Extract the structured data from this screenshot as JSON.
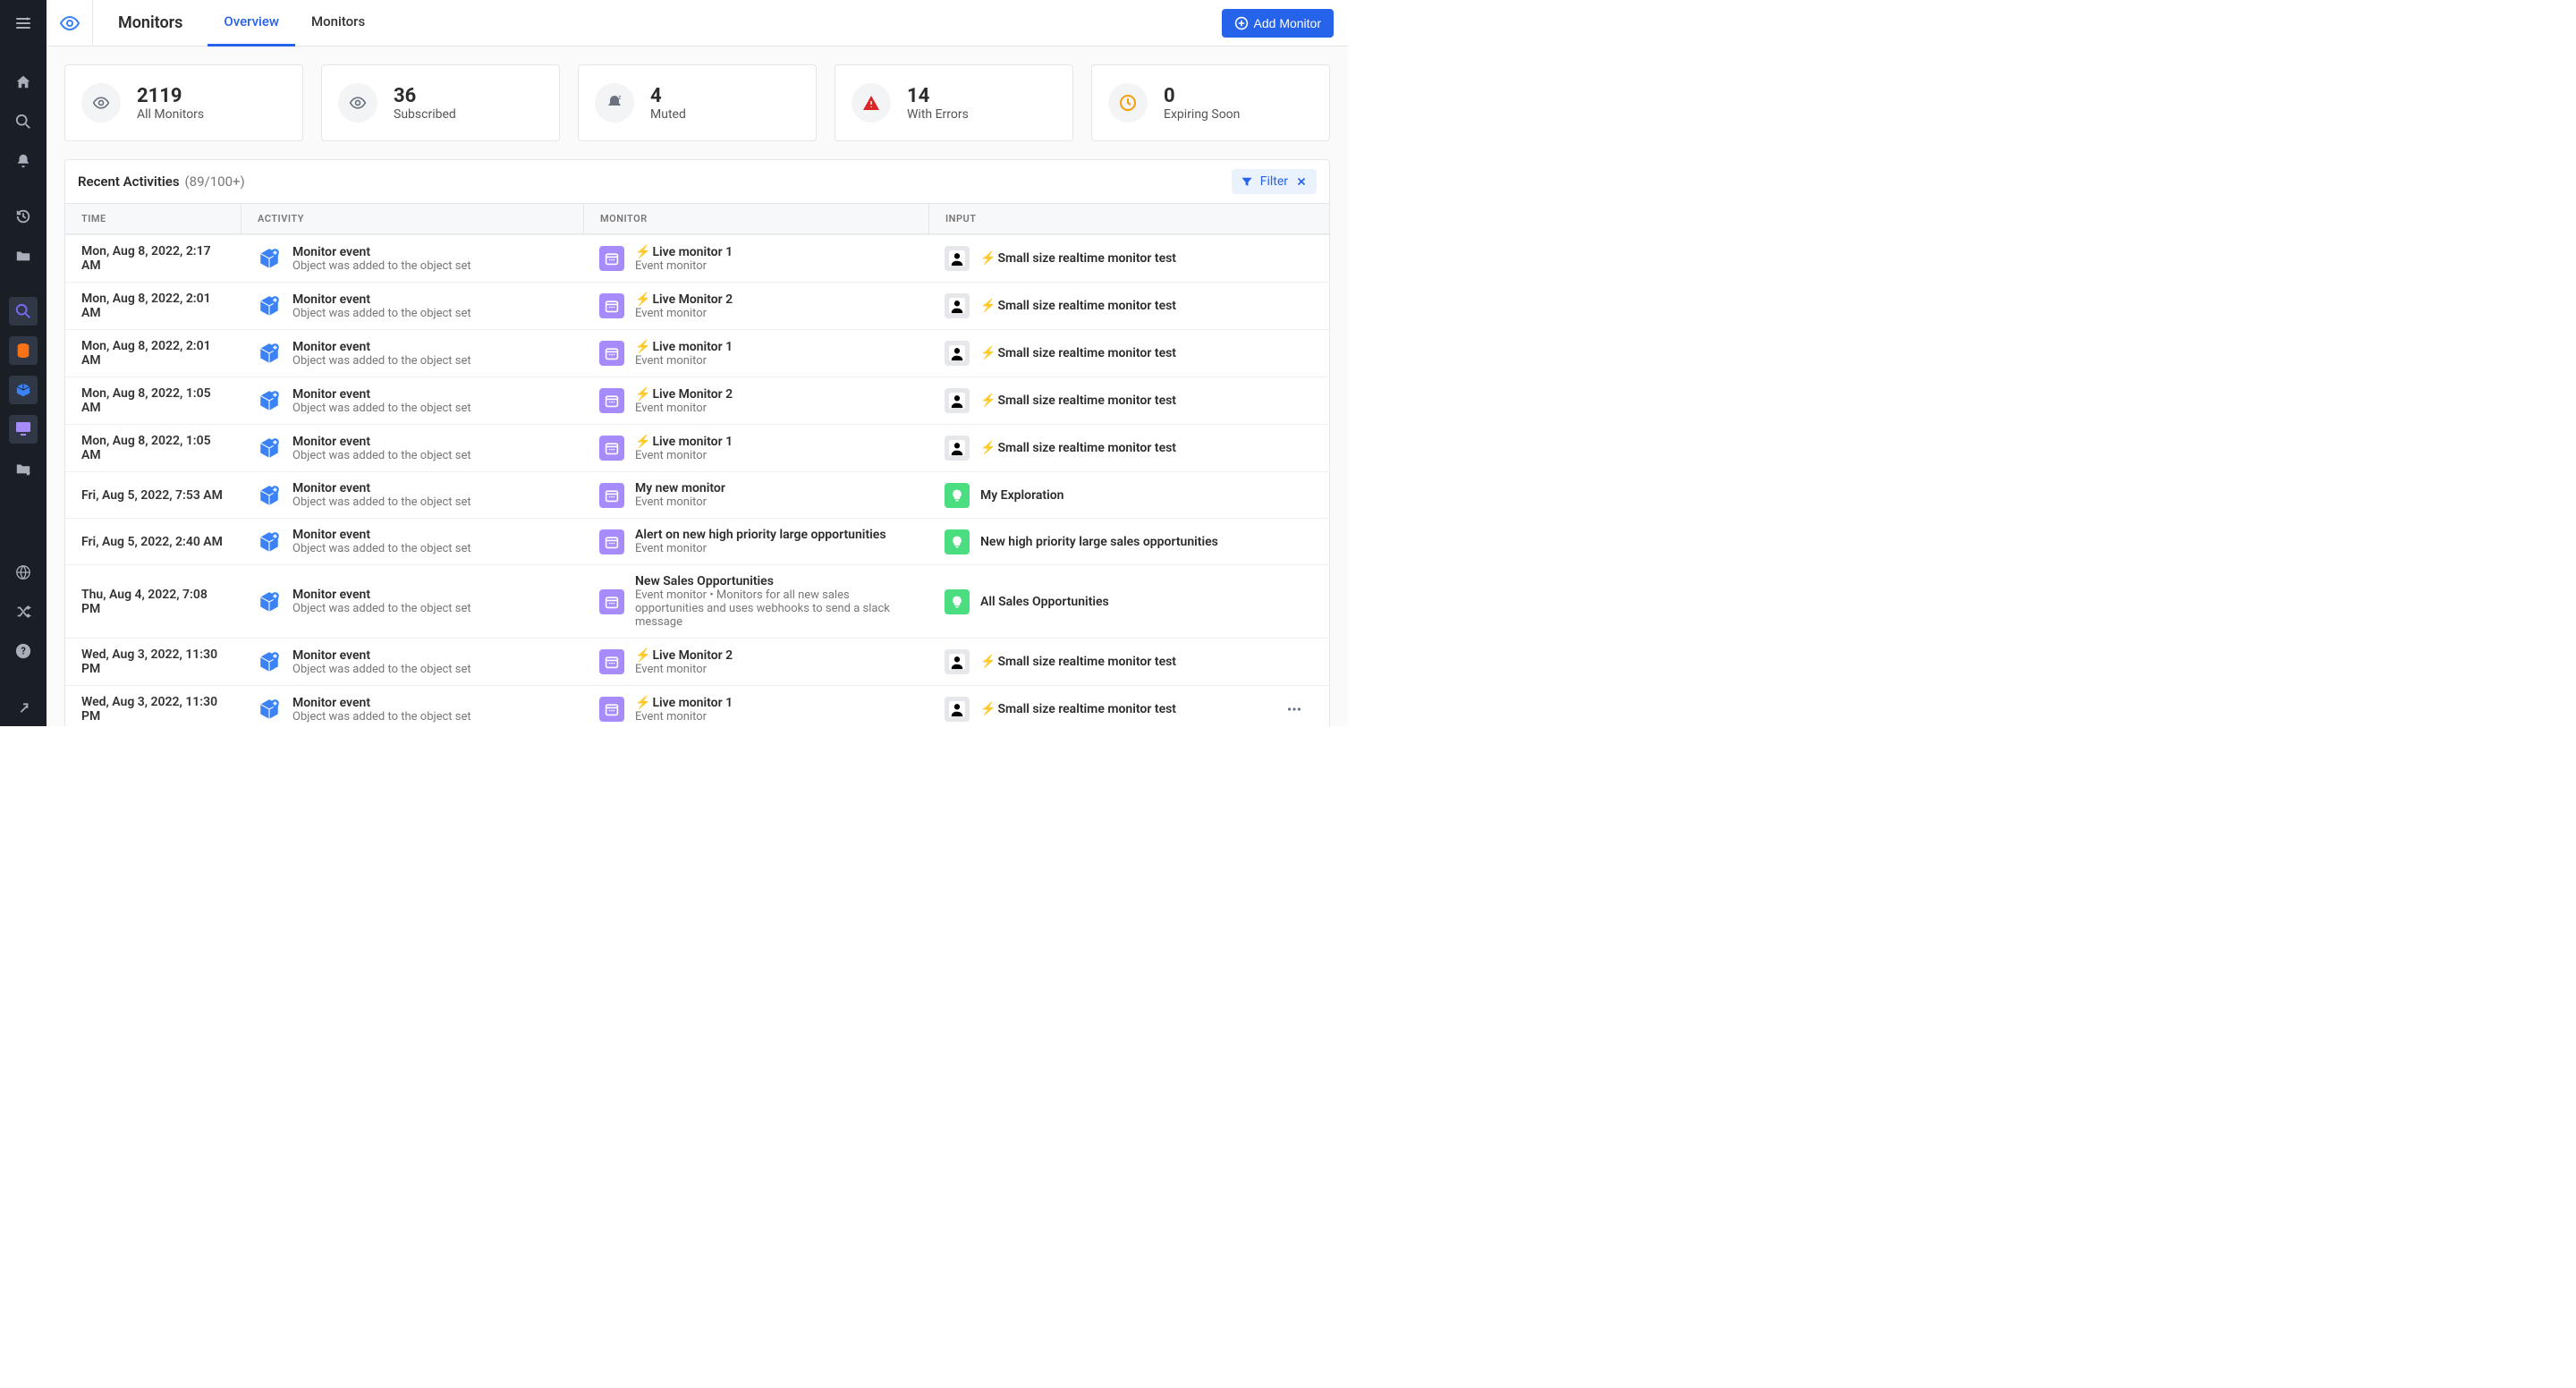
{
  "header": {
    "page_title": "Monitors",
    "tabs": {
      "overview": "Overview",
      "monitors": "Monitors"
    },
    "add_button": "Add Monitor"
  },
  "stats": {
    "all": {
      "value": "2119",
      "label": "All Monitors"
    },
    "subscribed": {
      "value": "36",
      "label": "Subscribed"
    },
    "muted": {
      "value": "4",
      "label": "Muted"
    },
    "errors": {
      "value": "14",
      "label": "With Errors"
    },
    "expiring": {
      "value": "0",
      "label": "Expiring Soon"
    }
  },
  "activities": {
    "title": "Recent Activities",
    "count": "(89/100+)",
    "filter_label": "Filter",
    "columns": {
      "time": "TIME",
      "activity": "ACTIVITY",
      "monitor": "MONITOR",
      "input": "INPUT"
    },
    "rows": [
      {
        "time": "Mon, Aug 8, 2022, 2:17 AM",
        "act_title": "Monitor event",
        "act_sub": "Object was added to the object set",
        "mon_live": true,
        "mon_title": "Live monitor 1",
        "mon_sub": "Event monitor",
        "in_type": "user",
        "in_live": true,
        "in_title": "Small size realtime monitor test"
      },
      {
        "time": "Mon, Aug 8, 2022, 2:01 AM",
        "act_title": "Monitor event",
        "act_sub": "Object was added to the object set",
        "mon_live": true,
        "mon_title": "Live Monitor 2",
        "mon_sub": "Event monitor",
        "in_type": "user",
        "in_live": true,
        "in_title": "Small size realtime monitor test"
      },
      {
        "time": "Mon, Aug 8, 2022, 2:01 AM",
        "act_title": "Monitor event",
        "act_sub": "Object was added to the object set",
        "mon_live": true,
        "mon_title": "Live monitor 1",
        "mon_sub": "Event monitor",
        "in_type": "user",
        "in_live": true,
        "in_title": "Small size realtime monitor test"
      },
      {
        "time": "Mon, Aug 8, 2022, 1:05 AM",
        "act_title": "Monitor event",
        "act_sub": "Object was added to the object set",
        "mon_live": true,
        "mon_title": "Live Monitor 2",
        "mon_sub": "Event monitor",
        "in_type": "user",
        "in_live": true,
        "in_title": "Small size realtime monitor test"
      },
      {
        "time": "Mon, Aug 8, 2022, 1:05 AM",
        "act_title": "Monitor event",
        "act_sub": "Object was added to the object set",
        "mon_live": true,
        "mon_title": "Live monitor 1",
        "mon_sub": "Event monitor",
        "in_type": "user",
        "in_live": true,
        "in_title": "Small size realtime monitor test"
      },
      {
        "time": "Fri, Aug 5, 2022, 7:53 AM",
        "act_title": "Monitor event",
        "act_sub": "Object was added to the object set",
        "mon_live": false,
        "mon_title": "My new monitor",
        "mon_sub": "Event monitor",
        "in_type": "light",
        "in_live": false,
        "in_title": "My Exploration"
      },
      {
        "time": "Fri, Aug 5, 2022, 2:40 AM",
        "act_title": "Monitor event",
        "act_sub": "Object was added to the object set",
        "mon_live": false,
        "mon_title": "Alert on new high priority large opportunities",
        "mon_sub": "Event monitor",
        "in_type": "light",
        "in_live": false,
        "in_title": "New high priority large sales opportunities"
      },
      {
        "time": "Thu, Aug 4, 2022, 7:08 PM",
        "act_title": "Monitor event",
        "act_sub": "Object was added to the object set",
        "mon_live": false,
        "mon_title": "New Sales Opportunities",
        "mon_sub": "Event monitor • Monitors for all new sales opportunities and uses webhooks to send a slack message",
        "in_type": "light",
        "in_live": false,
        "in_title": "All Sales Opportunities"
      },
      {
        "time": "Wed, Aug 3, 2022, 11:30 PM",
        "act_title": "Monitor event",
        "act_sub": "Object was added to the object set",
        "mon_live": true,
        "mon_title": "Live Monitor 2",
        "mon_sub": "Event monitor",
        "in_type": "user",
        "in_live": true,
        "in_title": "Small size realtime monitor test"
      },
      {
        "time": "Wed, Aug 3, 2022, 11:30 PM",
        "act_title": "Monitor event",
        "act_sub": "Object was added to the object set",
        "mon_live": true,
        "mon_title": "Live monitor 1",
        "mon_sub": "Event monitor",
        "in_type": "user",
        "in_live": true,
        "in_title": "Small size realtime monitor test",
        "menu": true
      }
    ]
  }
}
